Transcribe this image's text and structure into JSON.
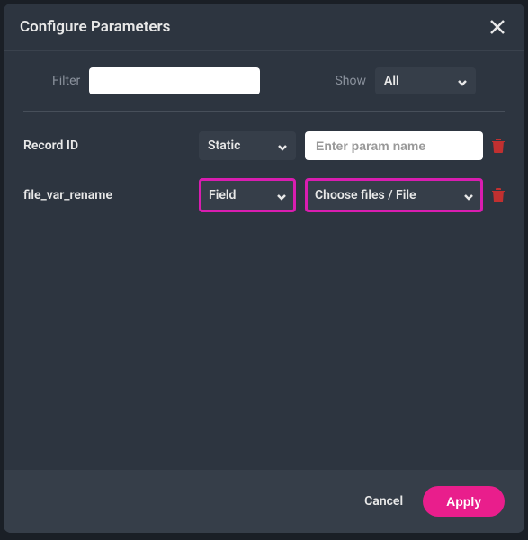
{
  "dialog": {
    "title": "Configure Parameters"
  },
  "filter": {
    "label": "Filter",
    "value": "",
    "show_label": "Show",
    "show_selected": "All"
  },
  "params": [
    {
      "label": "Record ID",
      "type_selected": "Static",
      "value_placeholder": "Enter param name",
      "value": "",
      "highlighted": false,
      "value_is_select": false
    },
    {
      "label": "file_var_rename",
      "type_selected": "Field",
      "value_selected": "Choose files / File",
      "highlighted": true,
      "value_is_select": true
    }
  ],
  "footer": {
    "cancel_label": "Cancel",
    "apply_label": "Apply"
  }
}
